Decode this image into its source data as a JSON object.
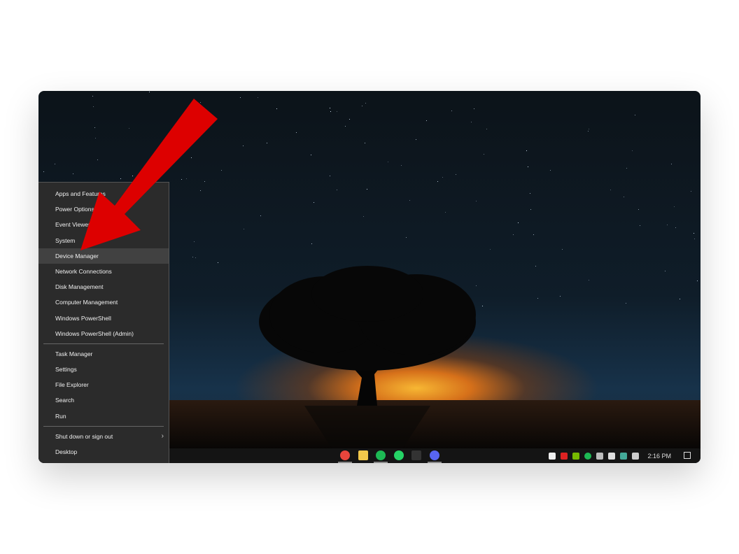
{
  "menu": {
    "items": [
      "Apps and Features",
      "Power Options",
      "Event Viewer",
      "System",
      "Device Manager",
      "Network Connections",
      "Disk Management",
      "Computer Management",
      "Windows PowerShell",
      "Windows PowerShell (Admin)"
    ],
    "items2": [
      "Task Manager",
      "Settings",
      "File Explorer",
      "Search",
      "Run"
    ],
    "items3": [
      "Shut down or sign out",
      "Desktop"
    ],
    "highlighted": "Device Manager"
  },
  "taskbar": {
    "apps": [
      {
        "icon": "chrome-icon",
        "color": "#e8453c"
      },
      {
        "icon": "file-explorer-icon",
        "color": "#f2c84b"
      },
      {
        "icon": "spotify-icon",
        "color": "#1db954"
      },
      {
        "icon": "whatsapp-icon",
        "color": "#25d366"
      },
      {
        "icon": "epic-games-icon",
        "color": "#333333"
      },
      {
        "icon": "discord-icon",
        "color": "#5865f2"
      }
    ],
    "tray": [
      "discord-icon",
      "vpn-icon",
      "nvidia-icon",
      "spotify-icon",
      "network-icon",
      "volume-icon",
      "color-icon",
      "display-icon"
    ],
    "clock": "2:16 PM"
  },
  "annotation": {
    "arrow_color": "#dd0000"
  }
}
